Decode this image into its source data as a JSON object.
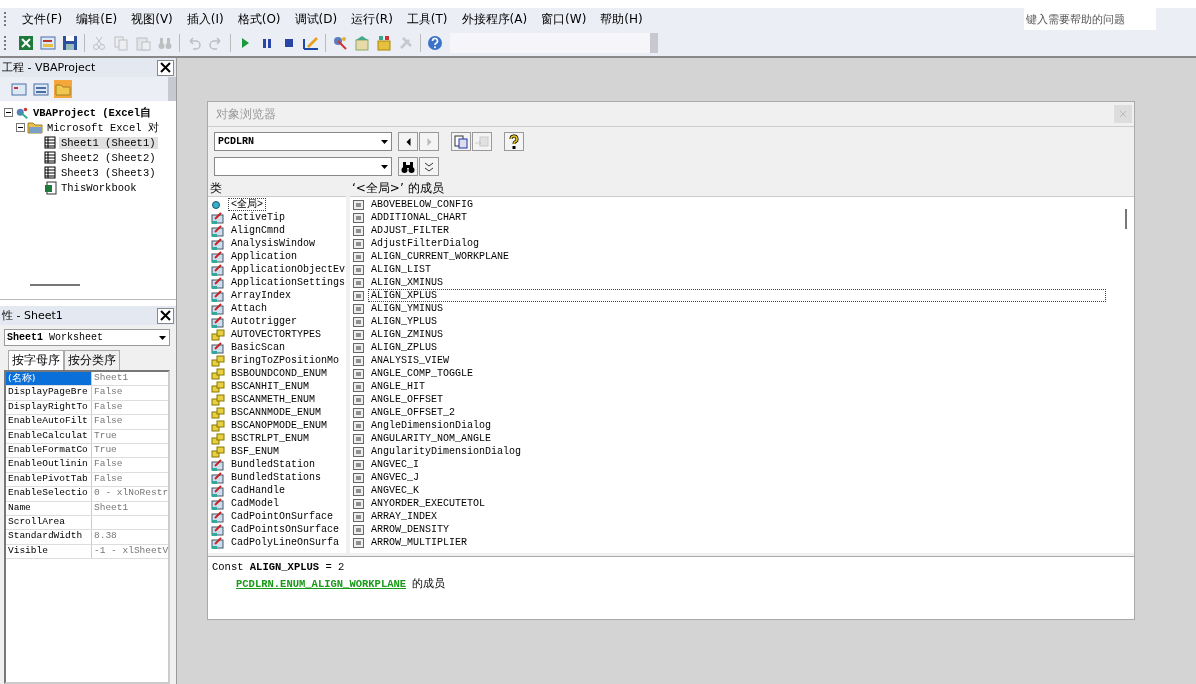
{
  "menu_bar": {
    "items": [
      "文件(F)",
      "编辑(E)",
      "视图(V)",
      "插入(I)",
      "格式(O)",
      "调试(D)",
      "运行(R)",
      "工具(T)",
      "外接程序(A)",
      "窗口(W)",
      "帮助(H)"
    ],
    "help_box": {
      "placeholder": "键入需要帮助的问题"
    }
  },
  "toolbar": [
    {
      "kind": "excel",
      "disabled": false
    },
    {
      "kind": "userform",
      "disabled": false
    },
    {
      "kind": "save",
      "disabled": false
    },
    {
      "kind": "cut",
      "disabled": true
    },
    {
      "kind": "copy",
      "disabled": true
    },
    {
      "kind": "paste",
      "disabled": true
    },
    {
      "kind": "find",
      "disabled": true
    },
    {
      "kind": "undo",
      "disabled": true
    },
    {
      "kind": "redo",
      "disabled": true
    },
    {
      "kind": "run",
      "disabled": false
    },
    {
      "kind": "pause",
      "disabled": false
    },
    {
      "kind": "stop",
      "disabled": false
    },
    {
      "kind": "design",
      "disabled": false
    },
    {
      "kind": "project",
      "disabled": false
    },
    {
      "kind": "properties",
      "disabled": false
    },
    {
      "kind": "browser",
      "disabled": false
    },
    {
      "kind": "toolbox",
      "disabled": true
    },
    {
      "kind": "help",
      "disabled": false
    }
  ],
  "project": {
    "title": "工程 - VBAProject",
    "toolbar": [
      {
        "kind": "code",
        "selected": false
      },
      {
        "kind": "object",
        "selected": false
      },
      {
        "kind": "folder",
        "selected": true
      }
    ],
    "tree": [
      {
        "label": "VBAProject (Excel自",
        "kind": "project",
        "expanded": true,
        "selected": false,
        "children": [
          {
            "label": "Microsoft Excel 对",
            "kind": "folder",
            "expanded": true,
            "selected": false,
            "children": [
              {
                "label": "Sheet1 (Sheet1)",
                "kind": "sheet",
                "selected": true
              },
              {
                "label": "Sheet2 (Sheet2)",
                "kind": "sheet",
                "selected": false
              },
              {
                "label": "Sheet3 (Sheet3)",
                "kind": "sheet",
                "selected": false
              },
              {
                "label": "ThisWorkbook",
                "kind": "workbook",
                "selected": false
              }
            ]
          }
        ]
      }
    ]
  },
  "properties": {
    "title": "性 - Sheet1",
    "object": "**Sheet1** Worksheet",
    "tabs": [
      {
        "label": "按字母序",
        "selected": true
      },
      {
        "label": "按分类序",
        "selected": false
      }
    ],
    "rows": [
      {
        "name": "(名称)",
        "value": "Sheet1",
        "selected": true
      },
      {
        "name": "DisplayPageBre",
        "value": "False",
        "selected": false
      },
      {
        "name": "DisplayRightTo",
        "value": "False",
        "selected": false
      },
      {
        "name": "EnableAutoFilt",
        "value": "False",
        "selected": false
      },
      {
        "name": "EnableCalculat",
        "value": "True",
        "selected": false
      },
      {
        "name": "EnableFormatCo",
        "value": "True",
        "selected": false
      },
      {
        "name": "EnableOutlinin",
        "value": "False",
        "selected": false
      },
      {
        "name": "EnablePivotTab",
        "value": "False",
        "selected": false
      },
      {
        "name": "EnableSelectio",
        "value": "0 - xlNoRestr",
        "selected": false
      },
      {
        "name": "Name",
        "value": "Sheet1",
        "selected": false
      },
      {
        "name": "ScrollArea",
        "selected": false
      },
      {
        "name": "StandardWidth",
        "value": "8.38",
        "selected": false
      },
      {
        "name": "Visible",
        "value": "-1 - xlSheetV",
        "selected": false
      }
    ]
  },
  "object_browser": {
    "title": "对象浏览器",
    "library": "PCDLRN",
    "buttons": [
      {
        "kind": "back",
        "disabled": false
      },
      {
        "kind": "forward",
        "disabled": true
      },
      {
        "kind": "copy",
        "disabled": false
      },
      {
        "kind": "definition",
        "disabled": true
      },
      {
        "kind": "help",
        "disabled": false
      }
    ],
    "search_buttons": [
      {
        "kind": "search"
      },
      {
        "kind": "toggle"
      }
    ],
    "classes_header": "类",
    "members_header": "‘<全局>’ 的成员",
    "classes": [
      {
        "name": "<全局>",
        "kind": "global",
        "selected": true
      },
      {
        "name": "ActiveTip",
        "kind": "class",
        "selected": false
      },
      {
        "name": "AlignCmnd",
        "kind": "class",
        "selected": false
      },
      {
        "name": "AnalysisWindow",
        "kind": "class",
        "selected": false
      },
      {
        "name": "Application",
        "kind": "class",
        "selected": false
      },
      {
        "name": "ApplicationObjectEv",
        "kind": "class",
        "selected": false
      },
      {
        "name": "ApplicationSettings",
        "kind": "class",
        "selected": false
      },
      {
        "name": "ArrayIndex",
        "kind": "class",
        "selected": false
      },
      {
        "name": "Attach",
        "kind": "class",
        "selected": false
      },
      {
        "name": "Autotrigger",
        "kind": "class",
        "selected": false
      },
      {
        "name": "AUTOVECTORTYPES",
        "kind": "enum",
        "selected": false
      },
      {
        "name": "BasicScan",
        "kind": "class",
        "selected": false
      },
      {
        "name": "BringToZPositionMo",
        "kind": "enum",
        "selected": false
      },
      {
        "name": "BSBOUNDCOND_ENUM",
        "kind": "enum",
        "selected": false
      },
      {
        "name": "BSCANHIT_ENUM",
        "kind": "enum",
        "selected": false
      },
      {
        "name": "BSCANMETH_ENUM",
        "kind": "enum",
        "selected": false
      },
      {
        "name": "BSCANNMODE_ENUM",
        "kind": "enum",
        "selected": false
      },
      {
        "name": "BSCANOPMODE_ENUM",
        "kind": "enum",
        "selected": false
      },
      {
        "name": "BSCTRLPT_ENUM",
        "kind": "enum",
        "selected": false
      },
      {
        "name": "BSF_ENUM",
        "kind": "enum",
        "selected": false
      },
      {
        "name": "BundledStation",
        "kind": "class",
        "selected": false
      },
      {
        "name": "BundledStations",
        "kind": "class",
        "selected": false
      },
      {
        "name": "CadHandle",
        "kind": "class",
        "selected": false
      },
      {
        "name": "CadModel",
        "kind": "class",
        "selected": false
      },
      {
        "name": "CadPointOnSurface",
        "kind": "class",
        "selected": false
      },
      {
        "name": "CadPointsOnSurface",
        "kind": "class",
        "selected": false
      },
      {
        "name": "CadPolyLineOnSurfa",
        "kind": "class",
        "selected": false
      }
    ],
    "members": [
      {
        "name": "ABOVEBELOW_CONFIG",
        "selected": false
      },
      {
        "name": "ADDITIONAL_CHART",
        "selected": false
      },
      {
        "name": "ADJUST_FILTER",
        "selected": false
      },
      {
        "name": "AdjustFilterDialog",
        "selected": false
      },
      {
        "name": "ALIGN_CURRENT_WORKPLANE",
        "selected": false
      },
      {
        "name": "ALIGN_LIST",
        "selected": false
      },
      {
        "name": "ALIGN_XMINUS",
        "selected": false
      },
      {
        "name": "ALIGN_XPLUS",
        "selected": true
      },
      {
        "name": "ALIGN_YMINUS",
        "selected": false
      },
      {
        "name": "ALIGN_YPLUS",
        "selected": false
      },
      {
        "name": "ALIGN_ZMINUS",
        "selected": false
      },
      {
        "name": "ALIGN_ZPLUS",
        "selected": false
      },
      {
        "name": "ANALYSIS_VIEW",
        "selected": false
      },
      {
        "name": "ANGLE_COMP_TOGGLE",
        "selected": false
      },
      {
        "name": "ANGLE_HIT",
        "selected": false
      },
      {
        "name": "ANGLE_OFFSET",
        "selected": false
      },
      {
        "name": "ANGLE_OFFSET_2",
        "selected": false
      },
      {
        "name": "AngleDimensionDialog",
        "selected": false
      },
      {
        "name": "ANGULARITY_NOM_ANGLE",
        "selected": false
      },
      {
        "name": "AngularityDimensionDialog",
        "selected": false
      },
      {
        "name": "ANGVEC_I",
        "selected": false
      },
      {
        "name": "ANGVEC_J",
        "selected": false
      },
      {
        "name": "ANGVEC_K",
        "selected": false
      },
      {
        "name": "ANYORDER_EXECUTETOL",
        "selected": false
      },
      {
        "name": "ARRAY_INDEX",
        "selected": false
      },
      {
        "name": "ARROW_DENSITY",
        "selected": false
      },
      {
        "name": "ARROW_MULTIPLIER",
        "selected": false
      }
    ],
    "details": {
      "declaration": "Const **ALIGN_XPLUS** = 2",
      "parent_link": "PCDLRN.ENUM_ALIGN_WORKPLANE",
      "parent_suffix": "的成员"
    }
  }
}
